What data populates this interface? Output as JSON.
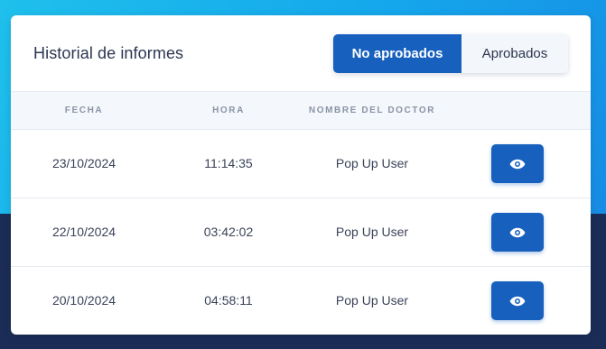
{
  "card": {
    "title": "Historial de informes"
  },
  "toggle": {
    "active_label": "No aprobados",
    "inactive_label": "Aprobados"
  },
  "table": {
    "headers": {
      "fecha": "FECHA",
      "hora": "HORA",
      "doctor": "NOMBRE DEL DOCTOR"
    },
    "rows": [
      {
        "fecha": "23/10/2024",
        "hora": "11:14:35",
        "doctor": "Pop Up User",
        "action_icon": "eye-icon"
      },
      {
        "fecha": "22/10/2024",
        "hora": "03:42:02",
        "doctor": "Pop Up User",
        "action_icon": "eye-icon"
      },
      {
        "fecha": "20/10/2024",
        "hora": "04:58:11",
        "doctor": "Pop Up User",
        "action_icon": "eye-icon"
      }
    ]
  },
  "colors": {
    "primary": "#1760bd",
    "title_text": "#2c3650",
    "header_bg": "#f4f7fb",
    "muted_text": "#8a94a6",
    "background_top": "#15a9ec",
    "background_bottom": "#1b2d57"
  }
}
